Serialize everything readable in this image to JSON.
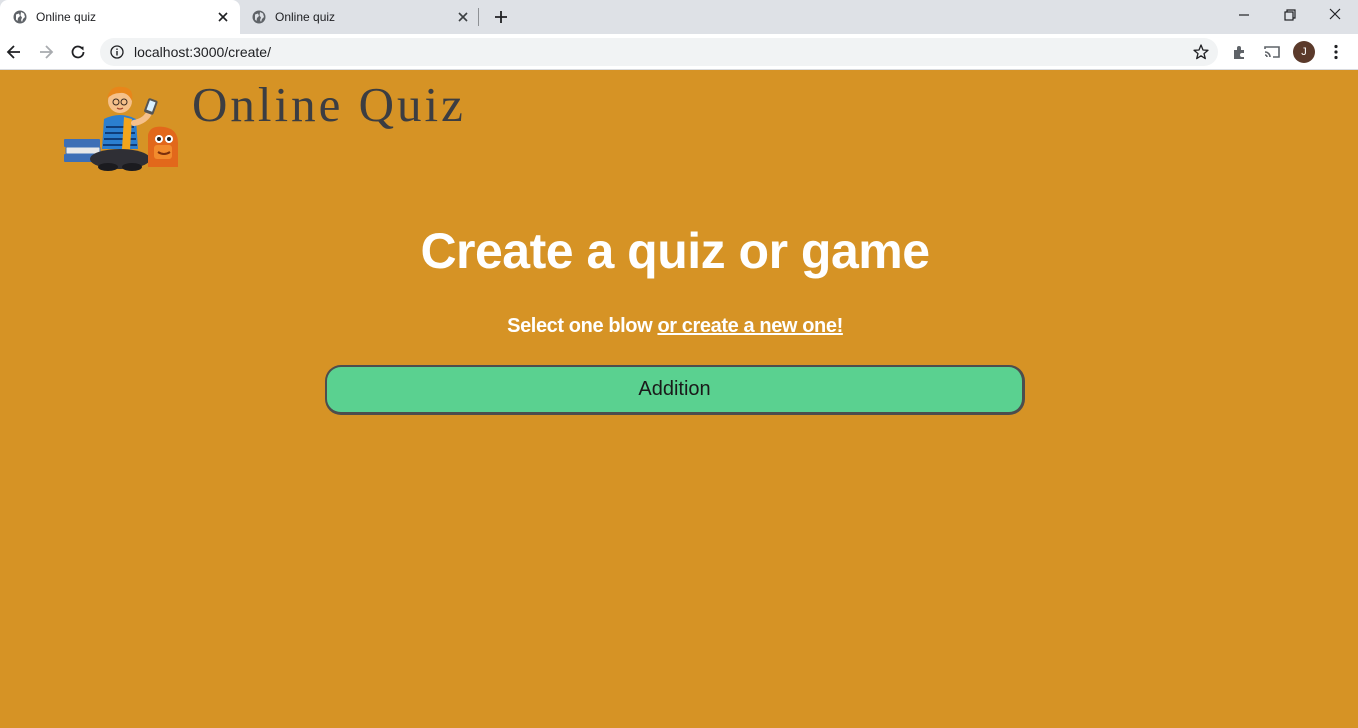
{
  "browser": {
    "tabs": [
      {
        "title": "Online quiz",
        "active": true
      },
      {
        "title": "Online quiz",
        "active": false
      }
    ],
    "address": "localhost:3000/create/",
    "profile_initial": "J"
  },
  "page": {
    "site_title": "Online Quiz",
    "heading": "Create a quiz or game",
    "subheading": "Select one blow",
    "create_link": "or create a new one!",
    "quizzes": [
      "Addition"
    ]
  },
  "colors": {
    "page_background": "#d69325",
    "quiz_button": "#5ad190",
    "title_text": "#3b3d42"
  },
  "icons": [
    "globe-icon",
    "close-icon",
    "plus-icon",
    "back-arrow-icon",
    "forward-arrow-icon",
    "reload-icon",
    "info-icon",
    "star-icon",
    "extensions-icon",
    "cast-icon",
    "more-icon",
    "minimize-icon",
    "restore-icon"
  ]
}
